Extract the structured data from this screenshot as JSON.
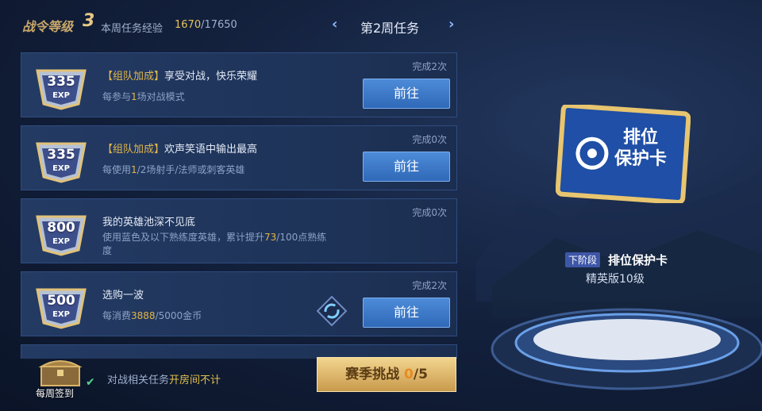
{
  "header": {
    "level_label": "战令等级",
    "level_value": "3",
    "weekly_exp_label": "本周任务经验",
    "exp_current": "1670",
    "exp_total": "/17650",
    "week_title": "第2周任务",
    "prev_icon": "chevron-left-icon",
    "next_icon": "chevron-right-icon"
  },
  "tasks": [
    {
      "exp": "335",
      "exp_unit": "EXP",
      "tag": "【组队加成】",
      "title": "享受对战，快乐荣耀",
      "desc_pre": "每参与",
      "desc_hl": "1",
      "desc_post": "场对战模式",
      "status": "完成2次",
      "button": "前往"
    },
    {
      "exp": "335",
      "exp_unit": "EXP",
      "tag": "【组队加成】",
      "title": "欢声笑语中输出最高",
      "desc_pre": "每使用",
      "desc_hl": "1",
      "desc_post": "/2场射手/法师或刺客英雄",
      "status": "完成0次",
      "button": "前往"
    },
    {
      "exp": "800",
      "exp_unit": "EXP",
      "tag": "",
      "title": "我的英雄池深不见底",
      "desc_pre": "使用蓝色及以下熟练度英雄，累计提升",
      "desc_hl": "73",
      "desc_post": "/100点熟练度",
      "status": "完成0次",
      "button": ""
    },
    {
      "exp": "500",
      "exp_unit": "EXP",
      "tag": "",
      "title": "选购一波",
      "desc_pre": "每消费",
      "desc_hl": "3888",
      "desc_post": "/5000金币",
      "status": "完成2次",
      "button": "前往"
    }
  ],
  "bottom": {
    "checkin_label": "每周签到",
    "notice_pre": "对战相关任务",
    "notice_warn": "开房间不计",
    "season_label": "赛季挑战 ",
    "season_progress": "0",
    "season_total": "/5"
  },
  "reward": {
    "card_text_line1": "排位",
    "card_text_line2": "保护卡",
    "stage_tag": "下阶段",
    "name": "排位保护卡",
    "level": "精英版10级"
  },
  "colors": {
    "accent_gold": "#e3b648",
    "button_blue": "#3a78c8",
    "check_green": "#55d68f"
  }
}
